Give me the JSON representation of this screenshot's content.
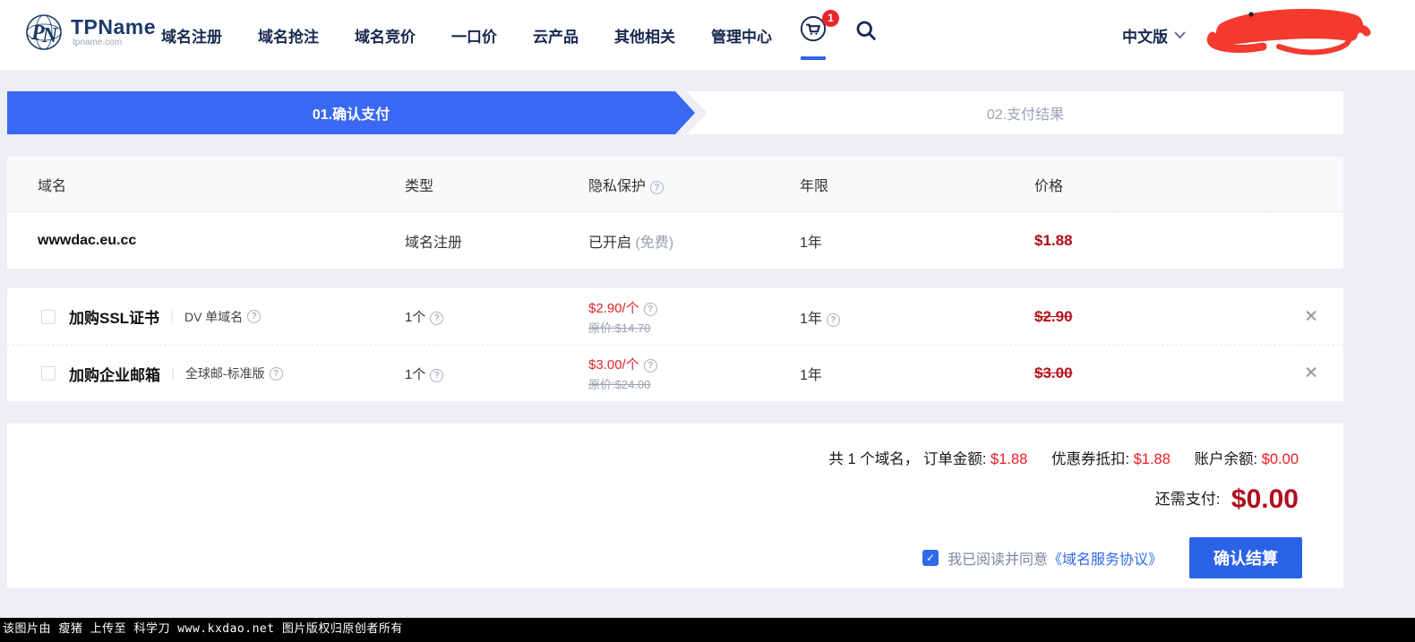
{
  "brand": {
    "name": "TPName",
    "domain": "tpname.com"
  },
  "nav": {
    "items": [
      "域名注册",
      "域名抢注",
      "域名竞价",
      "一口价",
      "云产品",
      "其他相关",
      "管理中心"
    ],
    "cart_badge": "1",
    "language": "中文版"
  },
  "steps": {
    "step1": "01.确认支付",
    "step2": "02.支付结果"
  },
  "order_table": {
    "headers": [
      "域名",
      "类型",
      "隐私保护",
      "年限",
      "价格"
    ],
    "row": {
      "domain": "wwwdac.eu.cc",
      "type": "域名注册",
      "privacy": "已开启",
      "privacy_note": "(免费)",
      "years": "1年",
      "price": "$1.88"
    }
  },
  "addons": [
    {
      "name": "加购SSL证书",
      "variant": "DV 单域名",
      "qty": "1个",
      "unit_price": "$2.90/个",
      "original_price": "原价:$14.70",
      "years": "1年",
      "total": "$2.90"
    },
    {
      "name": "加购企业邮箱",
      "variant": "全球邮-标准版",
      "qty": "1个",
      "unit_price": "$3.00/个",
      "original_price": "原价:$24.00",
      "years": "1年",
      "total": "$3.00"
    }
  ],
  "summary": {
    "count_label": "共 1 个域名，",
    "order_label": "订单金额:",
    "order_amount": "$1.88",
    "coupon_label": "优惠券抵扣:",
    "coupon_amount": "$1.88",
    "balance_label": "账户余额:",
    "balance_amount": "$0.00",
    "due_label": "还需支付:",
    "due_amount": "$0.00",
    "agree_text": "我已阅读并同意",
    "agreement_link": "《域名服务协议》",
    "checkout_button": "确认结算"
  },
  "footer": {
    "watermark": "该图片由 瘦猪 上传至 科学刀 www.kxdao.net 图片版权归原创者所有"
  },
  "colors": {
    "accent_blue": "#2f63ea",
    "step_blue": "#3a68f2",
    "button_blue": "#2b63e8",
    "link_blue": "#2f6ae8",
    "price_dark_red": "#b01020",
    "price_bright_red": "#ed1c24",
    "badge_red": "#e7262c",
    "scribble_red": "#f4392e",
    "navy_text": "#16294e"
  }
}
